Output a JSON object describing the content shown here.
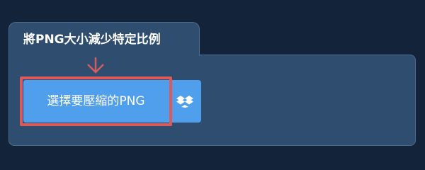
{
  "tab": {
    "title": "將PNG大小減少特定比例"
  },
  "upload": {
    "select_label": "選擇要壓縮的PNG",
    "dropbox_icon": "dropbox-icon"
  },
  "colors": {
    "background": "#13233a",
    "panel": "#2f4d6f",
    "button": "#4f9fec",
    "highlight": "#d95a5b"
  }
}
